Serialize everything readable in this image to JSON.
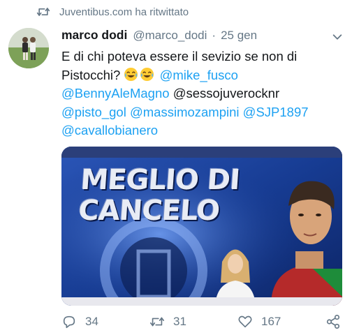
{
  "retweet_header": {
    "text": "Juventibus.com ha ritwittato",
    "icon": "retweet-icon"
  },
  "author": {
    "name": "marco dodi",
    "handle": "@marco_dodi",
    "separator": "·",
    "date": "25 gen",
    "avatar_icon": "avatar"
  },
  "tweet": {
    "text_before": "E di chi poteva essere il sevizio se non di Pistocchi?",
    "emojis": [
      "face-with-tears-of-joy-icon",
      "face-with-tears-of-joy-icon"
    ],
    "mention_1": "@mike_fusco",
    "mention_2": "@BennyAleMagno",
    "plain_handle": "@sessojuverocknr",
    "mention_3": "@pisto_gol",
    "mention_4": "@massimozampini",
    "mention_5": "@SJP1897",
    "mention_6": "@cavallobianero",
    "link_color": "#1da1f2"
  },
  "media": {
    "caption_line1": "MEGLIO DI",
    "caption_line2": "CANCELO"
  },
  "actions": {
    "reply_count": "34",
    "retweet_count": "31",
    "like_count": "167",
    "share_icon": "share-icon"
  }
}
